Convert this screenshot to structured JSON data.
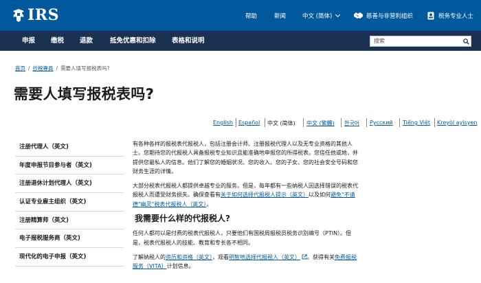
{
  "header": {
    "logo_text": "IRS",
    "utility": {
      "help": "帮助",
      "news": "新闻",
      "language": "中文 (简体)",
      "charities": "慈善与非营利组织",
      "tax_pros": "税务专业人士"
    }
  },
  "nav": {
    "items": [
      "申报",
      "缴税",
      "退款",
      "抵免优惠和扣除",
      "表格和说明"
    ],
    "search_placeholder": "搜索"
  },
  "breadcrumb": {
    "home": "首页",
    "section": "抄税專員",
    "current": "需要人填写报税表吗?"
  },
  "page_title": "需要人填写报税表吗?",
  "languages": [
    "English",
    "Español",
    "中文 (简体)",
    "中文 (繁體)",
    "한국어",
    "Русский",
    "Tiếng Việt",
    "Kreyòl ayisyen"
  ],
  "sidebar": {
    "items": [
      "注册代理人（英文)",
      "年度申报节目参与者（英文)",
      "注册退休计划代理人（英文)",
      "认证专业雇主组织（英文)",
      "注册精算师（英文)",
      "电子报税服务商（英文)",
      "现代化的电子申报（英文)"
    ]
  },
  "content": {
    "p1": "有各种各样的报税表代报税人，包括注册会计师、注册报税代理人以及无专业资格的其他人士。您期待您的代报税人具备报税专业知识且能准确地申报您的所得税表。您信任他或她，并提供您最私人的信息。他们了解您的婚姻状况、您的收入、您的子女、您的社会安全号码和您财务生涯的详情。",
    "p2_a": "大部分税表代报税人都提供卓越专业的服务。但是，每年都有一些纳税人因选择错误的税表代报税人而遭受财务损失。确保查看有",
    "p2_link1": "关于如何选择代报税人提示（英文）",
    "p2_b": "以及如何",
    "p2_link2": "避免\"不请德\"幽灵\"税表代报税人（英文）",
    "p2_c": "。",
    "h2": "我需要什么样的代报税人?",
    "p3": "任何人都可以是付费的税表代报税人，只要他们有国税局报税员税务识别编号（PTIN）。但是，税表代报税人的技能、教育和专长各不相同。",
    "p4_a": "了解纳税人的",
    "p4_link1": "资历和资格（英文）",
    "p4_b": "，观看",
    "p4_link2": "明智地选择代报税人（英文）",
    "p4_c": "。获得有关",
    "p4_link3": "免费报税服务（VITA）",
    "p4_d": "计划信息。"
  },
  "colors": {
    "topbar": "#00599c",
    "navbar": "#1b3152",
    "link": "#00599c"
  }
}
